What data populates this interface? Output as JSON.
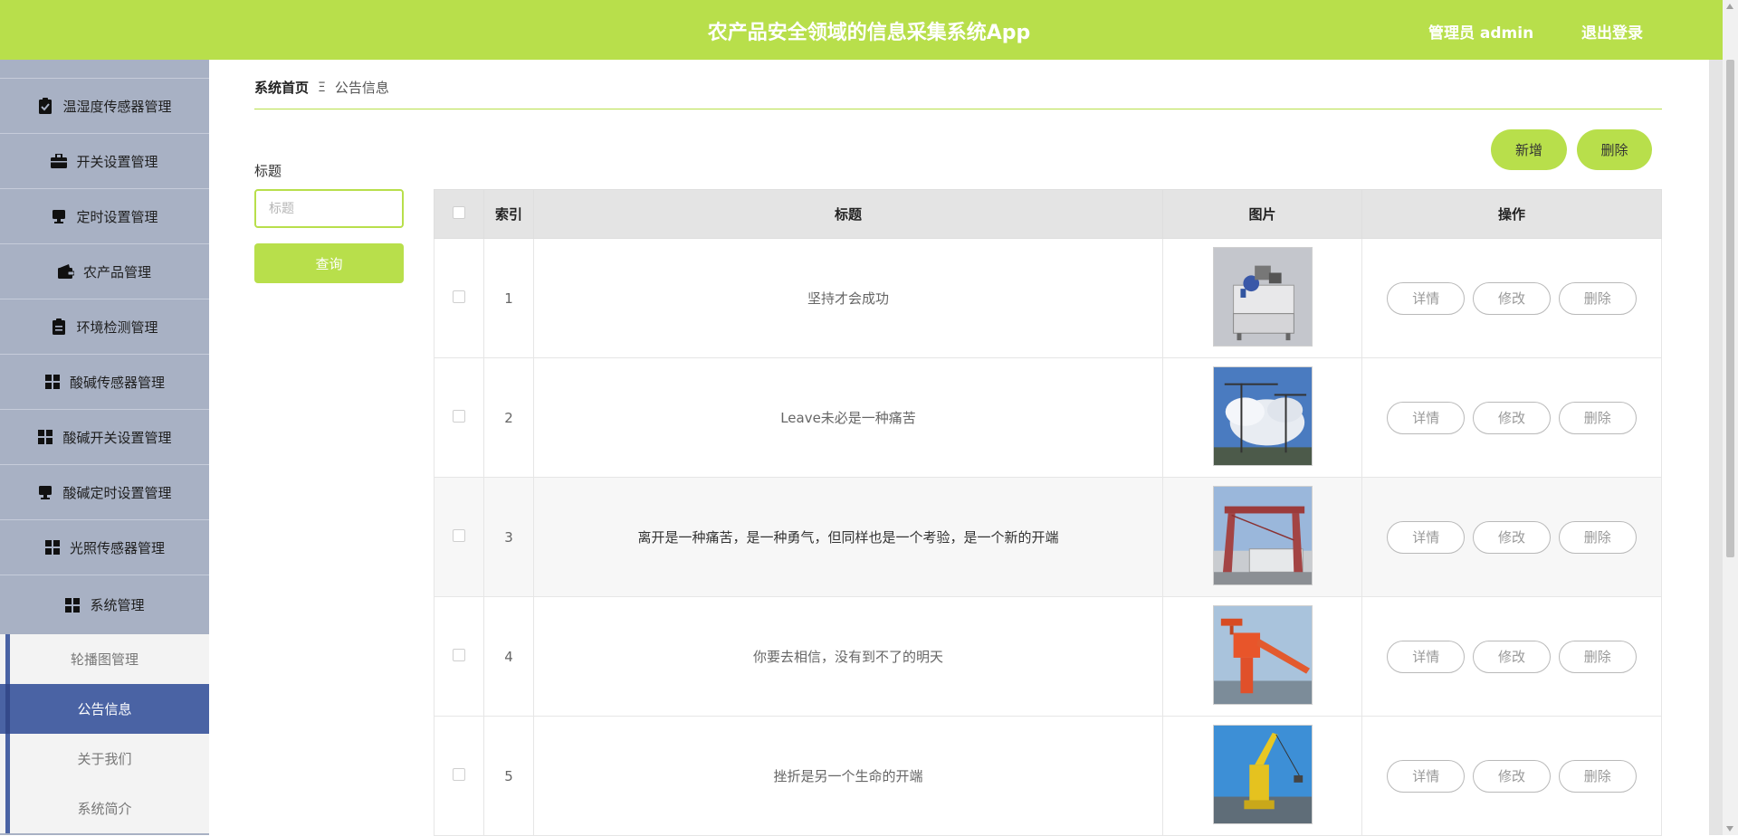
{
  "header": {
    "title": "农产品安全领域的信息采集系统App",
    "user": "管理员 admin",
    "logout": "退出登录",
    "color": "#b8df4b"
  },
  "sidebar": {
    "items": [
      {
        "label": "温湿度传感器管理",
        "icon": "clipboard-check-icon"
      },
      {
        "label": "开关设置管理",
        "icon": "briefcase-icon"
      },
      {
        "label": "定时设置管理",
        "icon": "monitor-icon"
      },
      {
        "label": "农产品管理",
        "icon": "wallet-icon"
      },
      {
        "label": "环境检测管理",
        "icon": "clipboard-icon"
      },
      {
        "label": "酸碱传感器管理",
        "icon": "grid-icon"
      },
      {
        "label": "酸碱开关设置管理",
        "icon": "grid-icon"
      },
      {
        "label": "酸碱定时设置管理",
        "icon": "monitor-icon"
      },
      {
        "label": "光照传感器管理",
        "icon": "grid-icon"
      },
      {
        "label": "系统管理",
        "icon": "grid-icon"
      }
    ],
    "subitems": [
      {
        "label": "轮播图管理",
        "active": false
      },
      {
        "label": "公告信息",
        "active": true
      },
      {
        "label": "关于我们",
        "active": false
      },
      {
        "label": "系统简介",
        "active": false
      }
    ]
  },
  "breadcrumb": {
    "home": "系统首页",
    "current": "公告信息"
  },
  "filter": {
    "label": "标题",
    "placeholder": "标题",
    "query_label": "查询"
  },
  "toolbar": {
    "add_label": "新增",
    "delete_label": "删除"
  },
  "table": {
    "headers": [
      "索引",
      "标题",
      "图片",
      "操作"
    ],
    "actions": [
      "详情",
      "修改",
      "删除"
    ],
    "rows": [
      {
        "index": "1",
        "title": "坚持才会成功",
        "image": "machine-equipment"
      },
      {
        "index": "2",
        "title": "Leave未必是一种痛苦",
        "image": "tower-crane-sky"
      },
      {
        "index": "3",
        "title": "离开是一种痛苦，是一种勇气，但同样也是一个考验，是一个新的开端",
        "image": "gantry-crane"
      },
      {
        "index": "4",
        "title": "你要去相信，没有到不了的明天",
        "image": "orange-port-crane"
      },
      {
        "index": "5",
        "title": "挫折是另一个生命的开端",
        "image": "yellow-port-crane"
      }
    ]
  }
}
